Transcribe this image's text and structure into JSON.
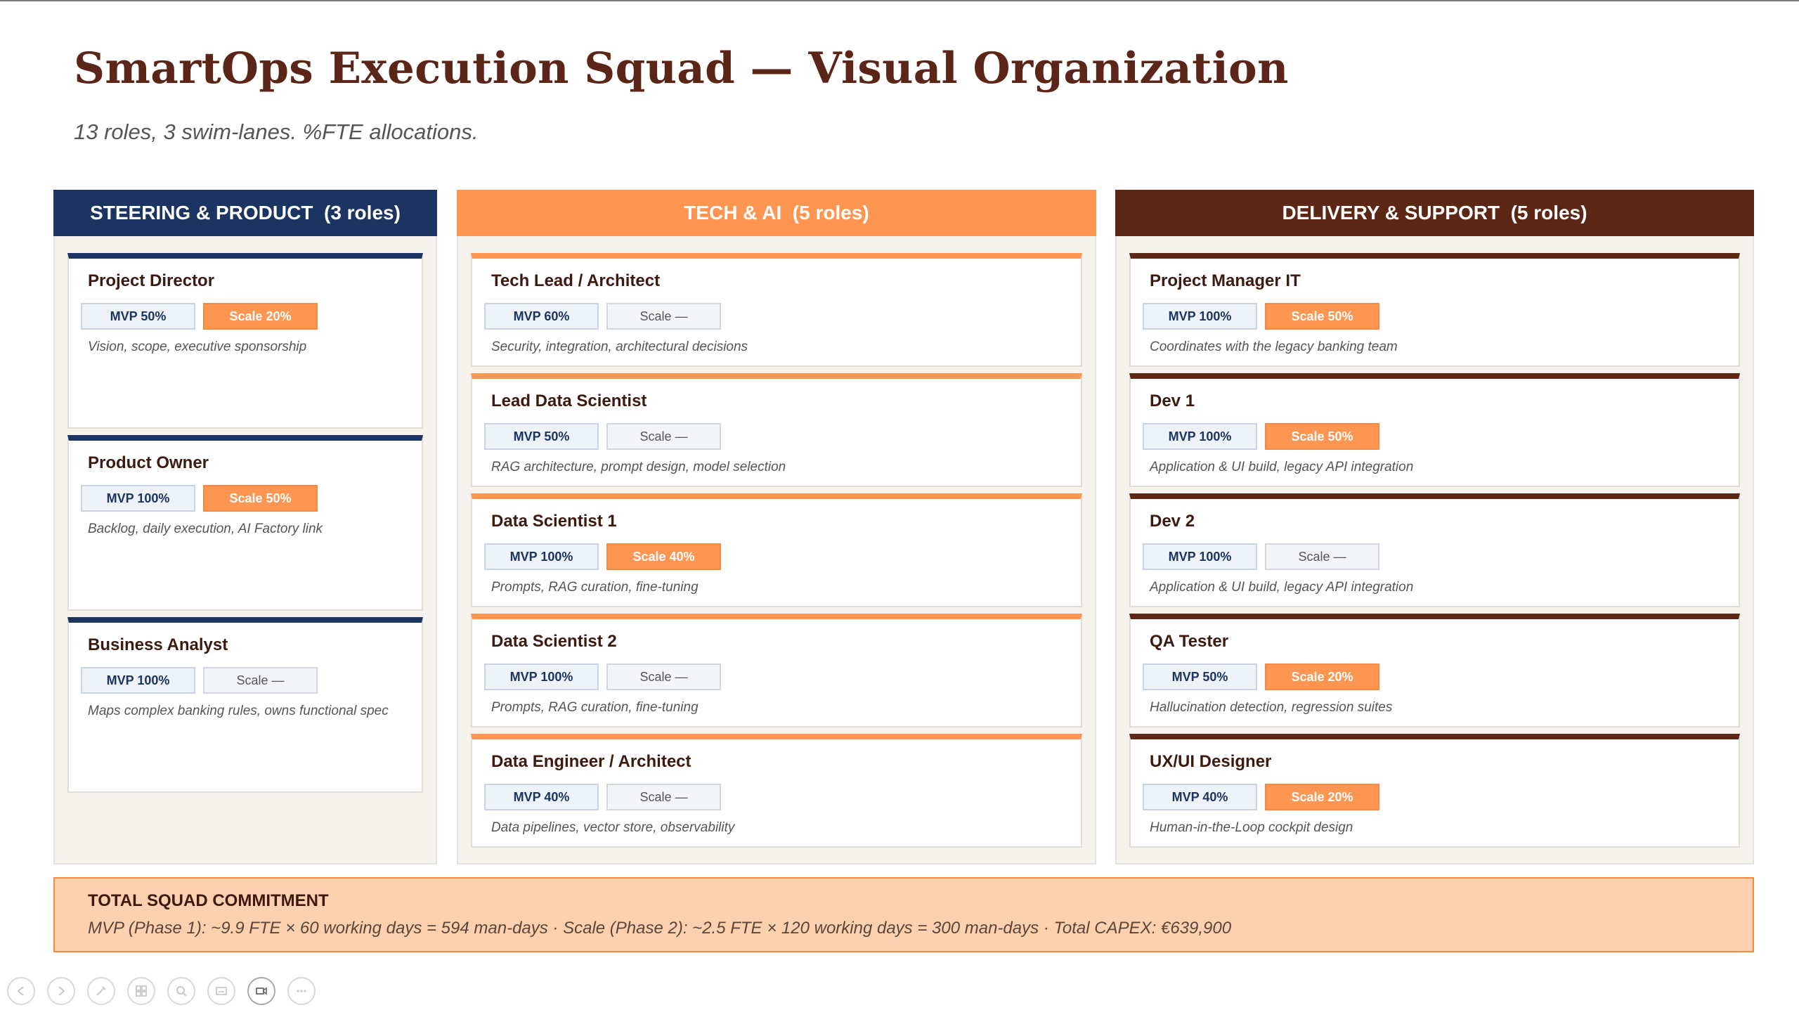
{
  "header": {
    "title": "SmartOps Execution Squad — Visual Organization",
    "subtitle": "13 roles, 3 swim-lanes. %FTE allocations."
  },
  "lanes": [
    {
      "title": "STEERING & PRODUCT  (3 roles)",
      "color": "#1c3461",
      "roles": [
        {
          "name": "Project Director",
          "mvp": "MVP 50%",
          "scale": "Scale 20%",
          "scale_active": true,
          "description": "Vision, scope, executive sponsorship"
        },
        {
          "name": "Product Owner",
          "mvp": "MVP 100%",
          "scale": "Scale 50%",
          "scale_active": true,
          "description": "Backlog, daily execution, AI Factory link"
        },
        {
          "name": "Business Analyst",
          "mvp": "MVP 100%",
          "scale": "Scale —",
          "scale_active": false,
          "description": "Maps complex banking rules, owns functional spec"
        }
      ]
    },
    {
      "title": "TECH & AI  (5 roles)",
      "color": "#fe9651",
      "roles": [
        {
          "name": "Tech Lead / Architect",
          "mvp": "MVP 60%",
          "scale": "Scale —",
          "scale_active": false,
          "description": "Security, integration, architectural decisions"
        },
        {
          "name": "Lead Data Scientist",
          "mvp": "MVP 50%",
          "scale": "Scale —",
          "scale_active": false,
          "description": "RAG architecture, prompt design, model selection"
        },
        {
          "name": "Data Scientist 1",
          "mvp": "MVP 100%",
          "scale": "Scale 40%",
          "scale_active": true,
          "description": "Prompts, RAG curation, fine-tuning"
        },
        {
          "name": "Data Scientist 2",
          "mvp": "MVP 100%",
          "scale": "Scale —",
          "scale_active": false,
          "description": "Prompts, RAG curation, fine-tuning"
        },
        {
          "name": "Data Engineer / Architect",
          "mvp": "MVP 40%",
          "scale": "Scale —",
          "scale_active": false,
          "description": "Data pipelines, vector store, observability"
        }
      ]
    },
    {
      "title": "DELIVERY & SUPPORT  (5 roles)",
      "color": "#5c2715",
      "roles": [
        {
          "name": "Project Manager IT",
          "mvp": "MVP 100%",
          "scale": "Scale 50%",
          "scale_active": true,
          "description": "Coordinates with the legacy banking team"
        },
        {
          "name": "Dev 1",
          "mvp": "MVP 100%",
          "scale": "Scale 50%",
          "scale_active": true,
          "description": "Application & UI build, legacy API integration"
        },
        {
          "name": "Dev 2",
          "mvp": "MVP 100%",
          "scale": "Scale —",
          "scale_active": false,
          "description": "Application & UI build, legacy API integration"
        },
        {
          "name": "QA Tester",
          "mvp": "MVP 50%",
          "scale": "Scale 20%",
          "scale_active": true,
          "description": "Hallucination detection, regression suites"
        },
        {
          "name": "UX/UI Designer",
          "mvp": "MVP 40%",
          "scale": "Scale 20%",
          "scale_active": true,
          "description": "Human-in-the-Loop cockpit design"
        }
      ]
    }
  ],
  "total": {
    "title": "TOTAL SQUAD COMMITMENT",
    "detail": "MVP (Phase 1): ~9.9 FTE × 60 working days = 594 man-days  ·  Scale (Phase 2): ~2.5 FTE × 120 working days = 300 man-days  ·  Total CAPEX: €639,900"
  },
  "presenter_toolbar": {
    "icons": [
      "previous-slide-icon",
      "next-slide-icon",
      "pen-icon",
      "slides-grid-icon",
      "zoom-icon",
      "subtitles-icon",
      "camera-icon",
      "more-options-icon"
    ],
    "active": "camera-icon"
  },
  "colors": {
    "title": "#5b2617",
    "steering": "#1c3461",
    "tech": "#fe9651",
    "delivery": "#5c2715",
    "total_bg": "#fdd0b0"
  }
}
